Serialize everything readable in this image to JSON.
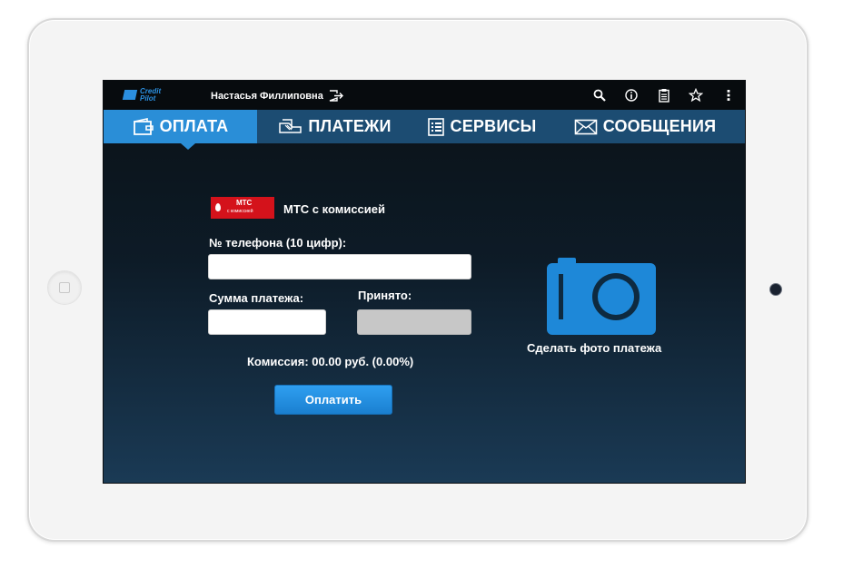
{
  "app": {
    "brand_line1": "Credit",
    "brand_line2": "Pilot",
    "user_name": "Настасья Филлиповна"
  },
  "statusbar_icons": [
    "search-icon",
    "info-icon",
    "clipboard-icon",
    "star-icon",
    "overflow-menu-icon"
  ],
  "tabs": [
    {
      "label": "ОПЛАТА",
      "icon": "wallet-icon",
      "active": true
    },
    {
      "label": "ПЛАТЕЖИ",
      "icon": "payments-icon",
      "active": false
    },
    {
      "label": "СЕРВИСЫ",
      "icon": "list-icon",
      "active": false
    },
    {
      "label": "СООБЩЕНИЯ",
      "icon": "envelope-icon",
      "active": false
    }
  ],
  "operator": {
    "logo_name": "МТС",
    "logo_sub": "с комиссией",
    "title": "МТС с комиссией"
  },
  "form": {
    "phone_label": "№ телефона (10 цифр):",
    "phone_value": "",
    "amount_label": "Сумма платежа:",
    "amount_value": "",
    "accepted_label": "Принято:",
    "accepted_value": "",
    "commission_text": "Комиссия: 00.00 руб. (0.00%)",
    "pay_button": "Оплатить"
  },
  "photo": {
    "label": "Сделать фото платежа"
  },
  "colors": {
    "accent": "#2a8ed7",
    "tab_bar": "#1c4c72",
    "operator_red": "#d4121b",
    "camera_blue": "#1e88d8"
  }
}
